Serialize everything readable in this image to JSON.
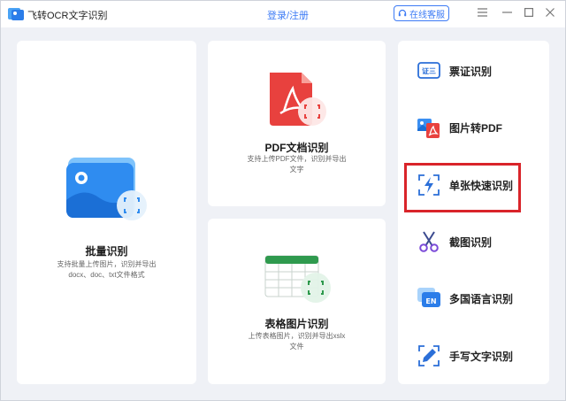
{
  "app": {
    "title": "飞转OCR文字识别"
  },
  "header": {
    "login_label": "登录/注册",
    "service_label": "在线客服"
  },
  "cards": {
    "batch": {
      "title": "批量识别",
      "desc_line1": "支持批量上传图片，识别并导出",
      "desc_line2": "docx、doc、txt文件格式"
    },
    "pdf": {
      "title": "PDF文档识别",
      "desc_line1": "支持上传PDF文件，识别并导出",
      "desc_line2": "文字"
    },
    "table": {
      "title": "表格图片识别",
      "desc_line1": "上传表格图片，识别并导出xslx",
      "desc_line2": "文件"
    }
  },
  "sidebar": {
    "items": [
      {
        "label": "票证识别",
        "icon": "ticket-icon"
      },
      {
        "label": "图片转PDF",
        "icon": "image-to-pdf-icon"
      },
      {
        "label": "单张快速识别",
        "icon": "quick-scan-icon"
      },
      {
        "label": "截图识别",
        "icon": "scissors-icon"
      },
      {
        "label": "多国语言识别",
        "icon": "language-icon"
      },
      {
        "label": "手写文字识别",
        "icon": "handwriting-icon"
      }
    ],
    "ticket_icon_text": "证三",
    "language_icon_text": "EN"
  },
  "colors": {
    "accent": "#3d7bf5",
    "highlight": "#d9242a",
    "pdf_red": "#e8413e",
    "table_green": "#2f9a4e"
  }
}
